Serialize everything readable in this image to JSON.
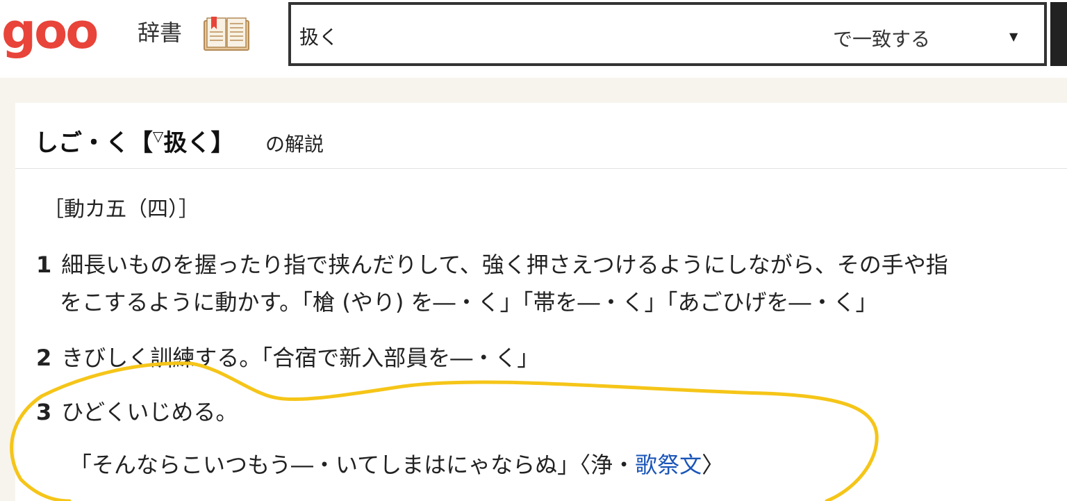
{
  "header": {
    "logo": "goo",
    "section_label": "辞書",
    "book_icon": "open-book-icon",
    "search": {
      "value": "扱く",
      "match_mode": "で一致する",
      "caret": "▼"
    }
  },
  "entry": {
    "title_reading": "しご・く【",
    "title_mark": "▽",
    "title_kanji": "扱く",
    "title_close": "】",
    "explain_label": "の解説",
    "part_of_speech": "［動カ五（四）］",
    "definitions": [
      {
        "num": "1",
        "line1": "細長いものを握ったり指で挟んだりして、強く押さえつけるようにしながら、その手や指",
        "line2": "をこするように動かす。「槍 (やり) を―・く」「帯を―・く」「あごひげを―・く」"
      },
      {
        "num": "2",
        "text": "きびしく訓練する。「合宿で新入部員を―・く」"
      },
      {
        "num": "3",
        "text": "ひどくいじめる。",
        "example_prefix": "「そんならこいつもう―・いてしまはにゃならぬ」〈浄・",
        "example_link": "歌祭文",
        "example_suffix": "〉"
      }
    ]
  },
  "colors": {
    "logo": "#e8443a",
    "link": "#1a55b8",
    "highlight": "#f5c518",
    "band": "#f7f4ee"
  }
}
